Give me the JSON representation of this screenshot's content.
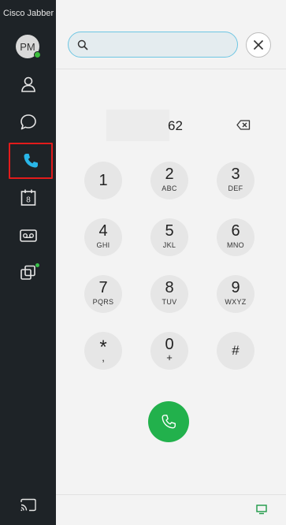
{
  "app": {
    "title": "Cisco Jabber"
  },
  "user": {
    "initials": "PM",
    "presence_color": "#3cbd3c"
  },
  "sidebar": {
    "items": [
      {
        "name": "contacts",
        "icon": "person-icon"
      },
      {
        "name": "chats",
        "icon": "chat-bubble-icon"
      },
      {
        "name": "calls",
        "icon": "phone-icon",
        "active": true
      },
      {
        "name": "meetings",
        "icon": "calendar-icon",
        "calendar_day": "8"
      },
      {
        "name": "voicemail",
        "icon": "voicemail-icon"
      },
      {
        "name": "custom-tabs",
        "icon": "copy-tabs-icon"
      }
    ],
    "footer_icon": "cast-icon"
  },
  "search": {
    "value": "",
    "placeholder": ""
  },
  "dialer": {
    "number": "62",
    "keys": [
      {
        "digit": "1",
        "letters": ""
      },
      {
        "digit": "2",
        "letters": "ABC"
      },
      {
        "digit": "3",
        "letters": "DEF"
      },
      {
        "digit": "4",
        "letters": "GHI"
      },
      {
        "digit": "5",
        "letters": "JKL"
      },
      {
        "digit": "6",
        "letters": "MNO"
      },
      {
        "digit": "7",
        "letters": "PQRS"
      },
      {
        "digit": "8",
        "letters": "TUV"
      },
      {
        "digit": "9",
        "letters": "WXYZ"
      },
      {
        "digit": "*",
        "letters": ","
      },
      {
        "digit": "0",
        "letters": "+"
      },
      {
        "digit": "#",
        "letters": ""
      }
    ]
  },
  "colors": {
    "sidebar_bg": "#1e2327",
    "accent": "#29b6e8",
    "call_green": "#22b14c",
    "highlight_red": "#e21b1b"
  }
}
